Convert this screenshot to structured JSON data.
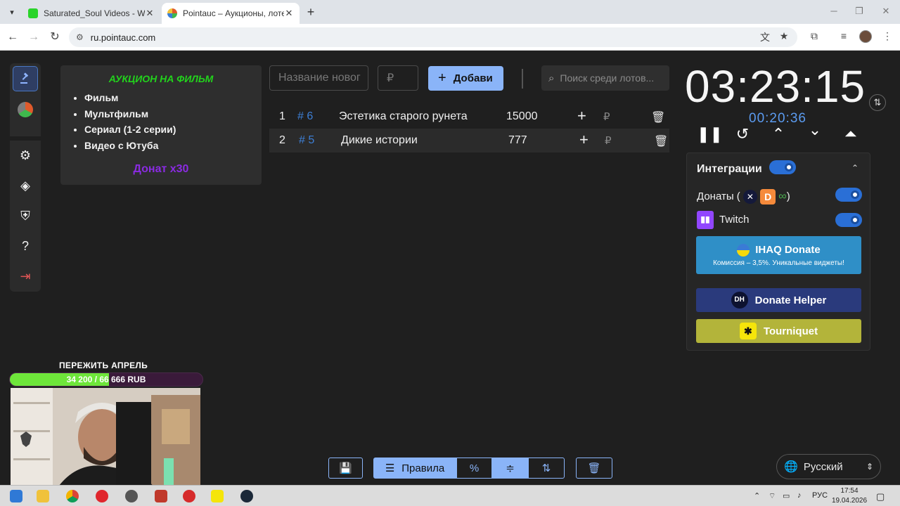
{
  "browser": {
    "tabs": [
      {
        "title": "Saturated_Soul Videos - Watch",
        "favicon_color": "#2ad42a"
      },
      {
        "title": "Pointauc – Аукционы, лотереи",
        "favicon_color": "#e05a2b"
      }
    ],
    "url": "ru.pointauc.com"
  },
  "rules": {
    "title": "АУКЦИОН НА ФИЛЬМ",
    "items": [
      "Фильм",
      "Мультфильм",
      "Сериал (1-2 серии)",
      "Видео с Ютуба"
    ],
    "donate": "Донат x30"
  },
  "controls": {
    "name_placeholder": "Название новог",
    "amount_placeholder": "₽",
    "add_label": "Добави",
    "search_placeholder": "Поиск среди лотов..."
  },
  "lots": [
    {
      "num": "1",
      "id": "# 6",
      "name": "Эстетика старого рунета",
      "amount": "15000",
      "currency": "₽"
    },
    {
      "num": "2",
      "id": "# 5",
      "name": "Дикие истории",
      "amount": "777",
      "currency": "₽"
    }
  ],
  "timer": {
    "main": "03:23:15",
    "sub": "00:20:36"
  },
  "integrations": {
    "title": "Интеграции",
    "donations_label": "Донаты (",
    "donations_close": ")",
    "twitch_label": "Twitch",
    "ihaq_title": "IHAQ Donate",
    "ihaq_sub": "Комиссия – 3,5%. Уникальные виджеты!",
    "donate_helper": "Donate Helper",
    "dh_logo": "DH",
    "tourniquet": "Tourniquet",
    "twitch_enabled": true,
    "donations_enabled": true,
    "integrations_enabled": true
  },
  "bottom": {
    "rules_label": "Правила",
    "percent_label": "%"
  },
  "language": "Русский",
  "overlay": {
    "goal_title": "ПЕРЕЖИТЬ АПРЕЛЬ",
    "goal_text": "34 200 / 66 666 RUB",
    "goal_progress": 0.513
  },
  "taskbar": {
    "lang": "РУС",
    "time": "17:54",
    "date": "19.04.2026"
  },
  "colors": {
    "accent": "#8ab4f8",
    "rules_title": "#22d21c",
    "donate_purple": "#8a2be2",
    "lot_id_blue": "#3d7fd6",
    "ihaq_bg": "#2f8fc7",
    "donate_helper_bg": "#2a3a7c",
    "tourniquet_bg": "#b3b43a"
  }
}
